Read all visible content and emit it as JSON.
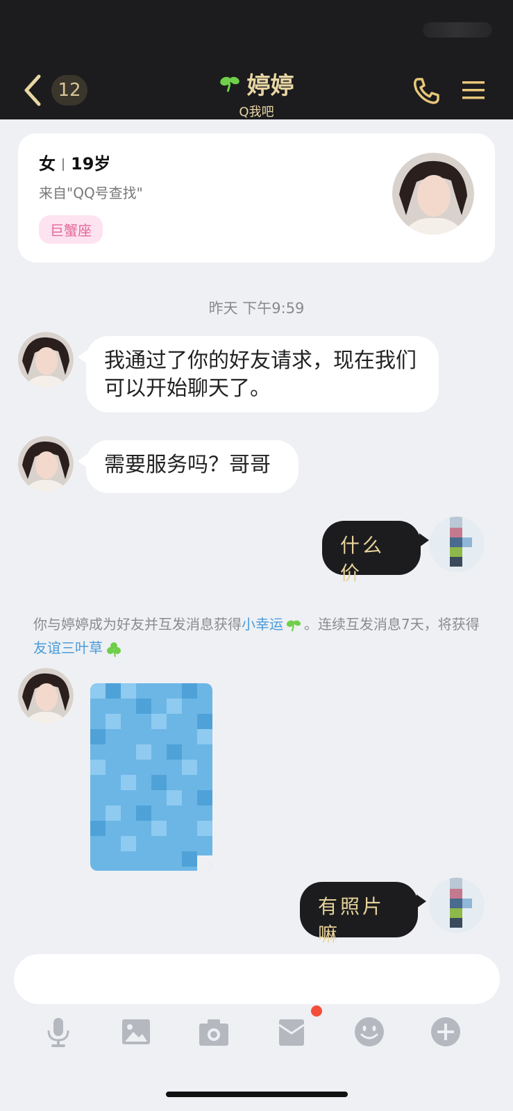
{
  "header": {
    "unread_count": "12",
    "title": "婷婷",
    "subtitle": "Q我吧"
  },
  "profile": {
    "gender": "女",
    "age": "19岁",
    "source": "来自\"QQ号查找\"",
    "zodiac": "巨蟹座"
  },
  "chat": {
    "timestamp": "昨天 下午9:59",
    "msg1": "我通过了你的好友请求，现在我们可以开始聊天了。",
    "msg2": "需要服务吗？哥哥",
    "msg3": "什么价",
    "system_part1": "你与婷婷成为好友并互发消息获得",
    "system_link1": "小幸运",
    "system_part2": "。连续互发消息7天，将获得",
    "system_link2": "友谊三叶草",
    "msg4": "有照片嘛"
  },
  "toolbar": {
    "icons": [
      "microphone-icon",
      "image-icon",
      "camera-icon",
      "red-packet-icon",
      "emoji-icon",
      "plus-icon"
    ]
  },
  "colors": {
    "header_bg": "#1c1c1e",
    "accent_gold": "#e8d6a4",
    "link_blue": "#4a9bd9",
    "background": "#eef0f4"
  }
}
